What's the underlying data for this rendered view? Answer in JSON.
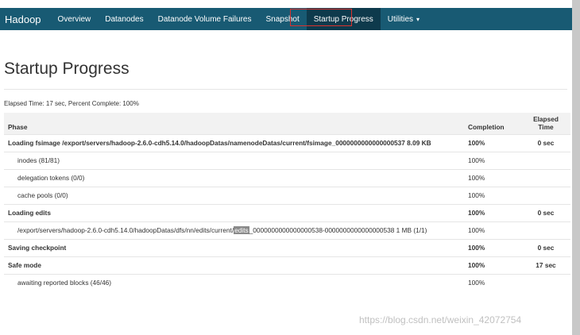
{
  "navbar": {
    "brand": "Hadoop",
    "items": [
      {
        "label": "Overview"
      },
      {
        "label": "Datanodes"
      },
      {
        "label": "Datanode Volume Failures"
      },
      {
        "label": "Snapshot"
      },
      {
        "label": "Startup Progress"
      },
      {
        "label": "Utilities"
      }
    ],
    "active": "Startup Progress",
    "utilities_caret": "▾"
  },
  "page": {
    "title": "Startup Progress",
    "summary": "Elapsed Time: 17 sec, Percent Complete: 100%"
  },
  "table": {
    "headers": {
      "phase": "Phase",
      "completion": "Completion",
      "elapsed_line1": "Elapsed",
      "elapsed_line2": "Time"
    },
    "rows": [
      {
        "kind": "phase",
        "phase": "Loading fsimage /export/servers/hadoop-2.6.0-cdh5.14.0/hadoopDatas/namenodeDatas/current/fsimage_0000000000000000537 8.09 KB",
        "completion": "100%",
        "elapsed": "0 sec"
      },
      {
        "kind": "step",
        "phase": "inodes (81/81)",
        "completion": "100%",
        "elapsed": ""
      },
      {
        "kind": "step",
        "phase": "delegation tokens (0/0)",
        "completion": "100%",
        "elapsed": ""
      },
      {
        "kind": "step",
        "phase": "cache pools (0/0)",
        "completion": "100%",
        "elapsed": ""
      },
      {
        "kind": "phase",
        "phase": "Loading edits",
        "completion": "100%",
        "elapsed": "0 sec"
      },
      {
        "kind": "step-wrap",
        "phase_before": "/export/servers/hadoop-2.6.0-cdh5.14.0/hadoopDatas/dfs/nn/edits/current/",
        "phase_mark": "edits",
        "phase_after": "_0000000000000000538-0000000000000000538 1 MB (1/1)",
        "completion": "100%",
        "elapsed": ""
      },
      {
        "kind": "phase",
        "phase": "Saving checkpoint",
        "completion": "100%",
        "elapsed": "0 sec"
      },
      {
        "kind": "phase",
        "phase": "Safe mode",
        "completion": "100%",
        "elapsed": "17 sec"
      },
      {
        "kind": "step",
        "phase": "awaiting reported blocks (46/46)",
        "completion": "100%",
        "elapsed": ""
      }
    ]
  },
  "watermark": "https://blog.csdn.net/weixin_42072754"
}
